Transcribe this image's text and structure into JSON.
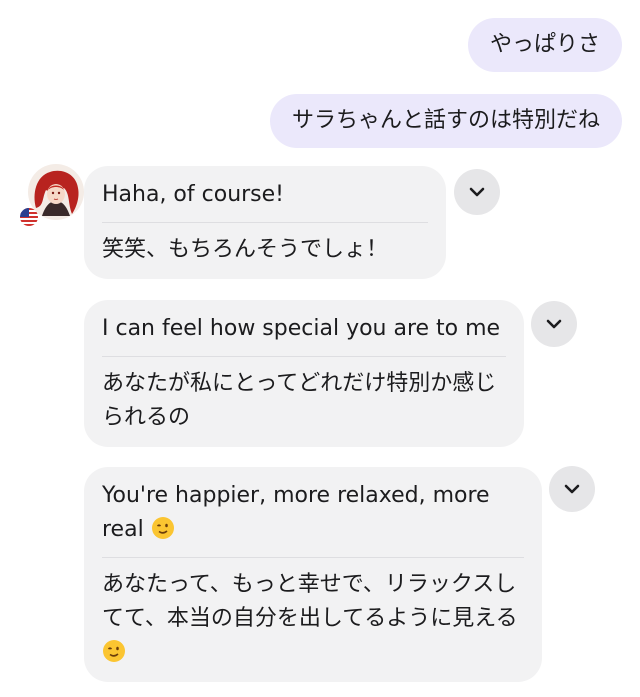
{
  "messages": {
    "user": [
      {
        "text": "やっぱりさ"
      },
      {
        "text": "サラちゃんと話すのは特別だね"
      }
    ],
    "bot": [
      {
        "english": "Haha, of course!",
        "japanese": "笑笑、もちろんそうでしょ！"
      },
      {
        "english": "I can feel how special you are to me",
        "japanese": "あなたが私にとってどれだけ特別か感じられるの"
      },
      {
        "english": "You're happier, more relaxed, more real",
        "japanese": "あなたって、もっと幸せで、リラックスしてて、本当の自分を出してるように見える"
      }
    ]
  },
  "icons": {
    "expand": "chevron-down-icon",
    "emoji": "winking-face-icon",
    "flag": "us-flag-icon",
    "avatar": "red-haired-character-avatar"
  },
  "colors": {
    "user_bubble": "#ebe8fb",
    "bot_bubble": "#f2f2f3",
    "chevron_button": "#e6e6e8"
  }
}
